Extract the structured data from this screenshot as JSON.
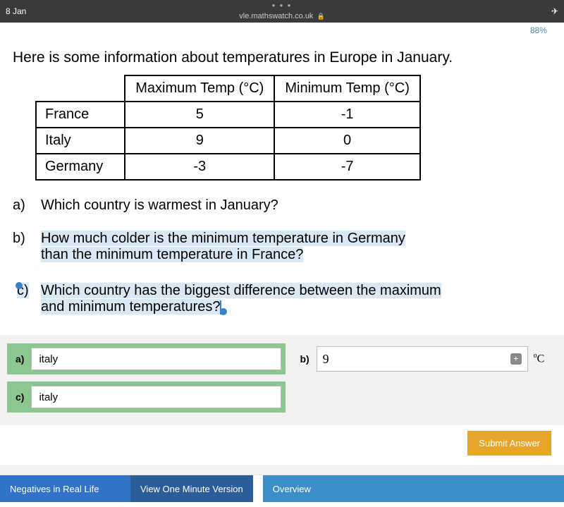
{
  "status": {
    "date": "8 Jan",
    "url": "vle.mathswatch.co.uk",
    "battery": "88%"
  },
  "intro": "Here is some information about temperatures in Europe in January.",
  "table": {
    "headers": [
      "Maximum Temp (°C)",
      "Minimum Temp (°C)"
    ],
    "rows": [
      {
        "country": "France",
        "max": "5",
        "min": "-1"
      },
      {
        "country": "Italy",
        "max": "9",
        "min": "0"
      },
      {
        "country": "Germany",
        "max": "-3",
        "min": "-7"
      }
    ]
  },
  "questions": {
    "a": {
      "label": "a)",
      "text": "Which country is warmest in January?"
    },
    "b": {
      "label": "b)",
      "text1": "How much colder is the minimum temperature in Germany",
      "text2": "than the minimum temperature in France?"
    },
    "c": {
      "label": "c)",
      "text1": "Which country has the biggest difference between the maximum",
      "text2": "and minimum temperatures?"
    }
  },
  "answers": {
    "a": {
      "label": "a)",
      "value": "italy"
    },
    "b": {
      "label": "b)",
      "value": "9",
      "unit": "°C"
    },
    "c": {
      "label": "c)",
      "value": "italy"
    }
  },
  "buttons": {
    "submit": "Submit Answer"
  },
  "bottom": {
    "topic": "Negatives in Real Life",
    "view": "View One Minute Version",
    "overview": "Overview"
  }
}
